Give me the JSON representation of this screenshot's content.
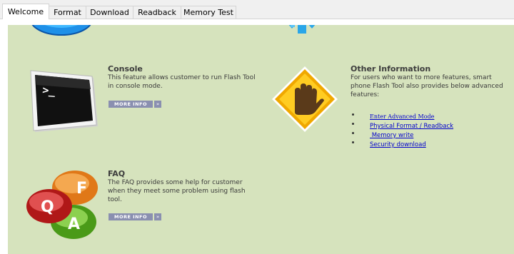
{
  "tabs": [
    {
      "label": "Welcome",
      "active": true
    },
    {
      "label": "Format",
      "active": false
    },
    {
      "label": "Download",
      "active": false
    },
    {
      "label": "Readback",
      "active": false
    },
    {
      "label": "Memory Test",
      "active": false
    }
  ],
  "console": {
    "title": "Console",
    "description_lines": [
      "This feature allows customer to run Flash Tool",
      "in console mode."
    ],
    "more_info_label": "MORE INFO",
    "icon": "terminal-icon"
  },
  "other": {
    "title": "Other Information",
    "description_lines": [
      "For users who want to more features, smart",
      "phone Flash Tool also provides below advanced",
      "features:"
    ],
    "icon": "hand-stop-icon",
    "links": [
      "Enter Advanced Mode",
      "Physical Format / Readback",
      " Memory write",
      "Security download"
    ]
  },
  "faq": {
    "title": "FAQ",
    "description_lines": [
      "The FAQ provides some help for customer",
      "when they meet some problem using flash",
      "tool."
    ],
    "more_info_label": "MORE INFO",
    "icon": "faq-bubbles-icon",
    "bubble_letters": [
      "F",
      "Q",
      "A"
    ]
  },
  "colors": {
    "content_background": "#d6e3bd",
    "link": "#0000cc",
    "button": "#8a8fb0"
  }
}
